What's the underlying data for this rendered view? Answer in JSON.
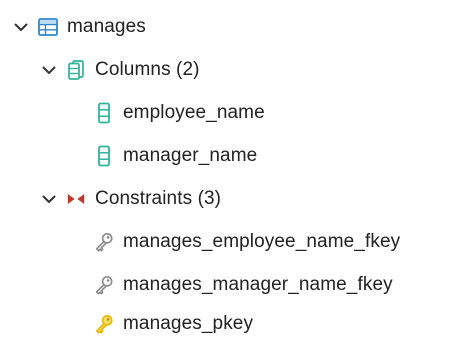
{
  "tree": {
    "table": {
      "label": "manages",
      "icon": "table-icon",
      "expanded": true
    },
    "columns": {
      "label": "Columns (2)",
      "icon": "columns-icon",
      "expanded": true,
      "items": [
        {
          "label": "employee_name",
          "icon": "column-icon"
        },
        {
          "label": "manager_name",
          "icon": "column-icon"
        }
      ]
    },
    "constraints": {
      "label": "Constraints (3)",
      "icon": "constraints-icon",
      "expanded": true,
      "items": [
        {
          "label": "manages_employee_name_fkey",
          "icon": "foreign-key-icon"
        },
        {
          "label": "manages_manager_name_fkey",
          "icon": "foreign-key-icon"
        },
        {
          "label": "manages_pkey",
          "icon": "primary-key-icon"
        }
      ]
    }
  },
  "colors": {
    "table_icon": "#2f86c9",
    "column_icon": "#2fb39a",
    "constraint_icon": "#c0392b",
    "foreign_key_icon": "#8a8a8a",
    "primary_key_icon": "#e6b800",
    "chevron": "#333333",
    "text": "#222222"
  }
}
